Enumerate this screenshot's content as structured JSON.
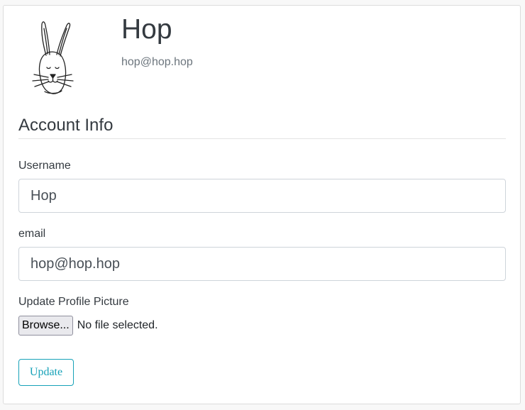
{
  "profile": {
    "name": "Hop",
    "email": "hop@hop.hop",
    "avatar_icon": "rabbit-sketch-icon"
  },
  "account_info": {
    "title": "Account Info",
    "username_label": "Username",
    "username_value": "Hop",
    "email_label": "email",
    "email_value": "hop@hop.hop",
    "picture_label": "Update Profile Picture",
    "browse_label": "Browse...",
    "file_status": "No file selected.",
    "update_label": "Update"
  },
  "colors": {
    "accent": "#17a2b8",
    "border": "#ced4da",
    "page_background": "#f8f8f8"
  }
}
